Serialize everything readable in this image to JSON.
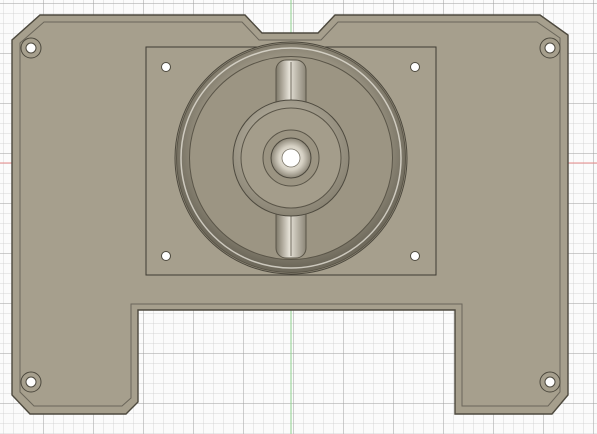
{
  "scene": {
    "view": "top-orthographic",
    "background_color": "#fbfbfb",
    "grid_visible": true,
    "origin_axes_visible": true,
    "axis_colors": {
      "x": "#e88a8a",
      "y": "#8ecf8e"
    },
    "part": {
      "name": "fan-mount-plate",
      "body_color": "#a69f8d",
      "edge_color": "#5a5548",
      "mounting_holes": 4,
      "fan_holes": 4,
      "features": [
        "outer-ring",
        "inner-hub",
        "center-bore",
        "top-notch",
        "bottom-cutout"
      ]
    }
  }
}
